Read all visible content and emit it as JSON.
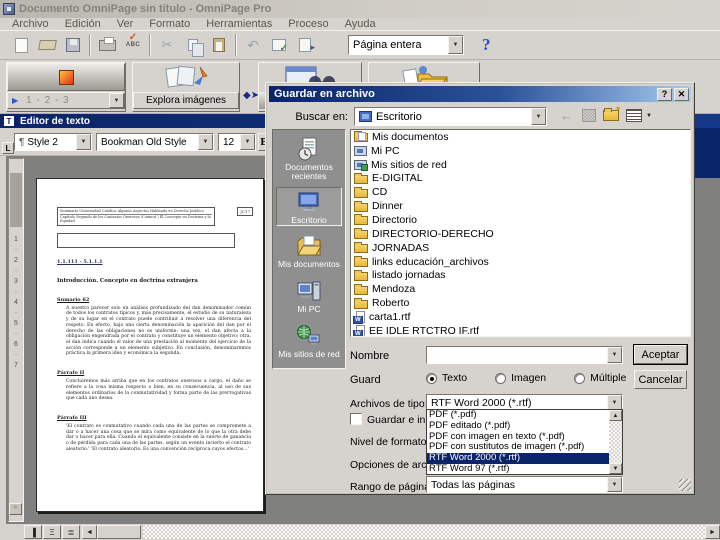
{
  "colors": {
    "window_bg": "#d6d3ce",
    "titlebar_inactive": "#c6c3bb",
    "accent_navy": "#0a246a",
    "doc_area_gray": "#80807e",
    "places_bar_gray": "#8f8f8f",
    "selection_bg": "#0a246a",
    "selection_text": "#ffffff"
  },
  "window": {
    "title": "Documento OmniPage sin título - OmniPage Pro"
  },
  "menu": [
    "Archivo",
    "Edición",
    "Ver",
    "Formato",
    "Herramientas",
    "Proceso",
    "Ayuda"
  ],
  "toolbar": {
    "page_view_value": "Página entera",
    "help": "?"
  },
  "workflow": {
    "steps": "1 - 2 - 3",
    "explore": "Explora imágenes"
  },
  "editor": {
    "title": "Editor de texto",
    "panel_icon": "T",
    "tab_button": "L",
    "style_value": "Style 2",
    "font_value": "Bookman Old Style",
    "size_value": "12",
    "bold_button": "B",
    "ruler": [
      "1",
      "2",
      "3",
      "4",
      "5",
      "6",
      "7"
    ]
  },
  "page": {
    "header_line1": "Seminario Universidad Católica  Algunos Aspectos Hablando en Derecho Jurídico",
    "header_line2": "Capítulo Segundo de los Contratos Onerosos (Conmut.)  El Concepto en Doctrina y la Equidad",
    "page_ref": "JC17",
    "link_heading": "1.1.111 - 5.1.1.1",
    "intro_heading": "Introducción. Concepto en doctrina extranjera",
    "sections": [
      {
        "heading": "Sumario 62",
        "body": "A nuestro parecer solo un análisis profundizado del dan denominador común de todos los contratos típicos y, más precisamente, el estudio de su naturaleza y de su lugar en el contrato puede contribuir a resolver una diferencia del respeto. En efecto, bajo una cierta denominación la aparición del dan por el derecho de las obligaciones no es uniforme: una vez, el dan afecta a la obligación engendrada por el contrato y constituye un elemento objetivo; otra, el dan indica cuando el valor de una prestación al momento del ejercicio de la acción corresponde a un elemento subjetivo. En conclusión, denominaremos práctica la primera idea y económica la segunda."
      },
      {
        "heading": "Párrafo II",
        "body": "Concluiremos más arriba que en los contratos onerosos a cargo, el daño se refiere a la cosa misma respecto o bien, en su consecuencia, al uso de sus elementos ordinarios de la conmutatividad y forma parte de las prerrogativas que cada uno desea."
      },
      {
        "heading": "Párrafo III",
        "body": "'El contrato es conmutativo cuando cada una de las partes se compromete a dar o a hacer una cosa que se mira como equivalente de lo que la otra debe dar o hacer para ella. Cuando el equivalente consiste en la suerte de ganancia o de pérdida para cada una de las partes, según un evento incierto el contrato aleatorio.'  'El contrato aleatorio. Es una convención recíproca cuyos efectos...'"
      }
    ]
  },
  "dialog": {
    "title": "Guardar en archivo",
    "help_button": "?",
    "close_button": "✕",
    "look_in": {
      "label": "Buscar en:",
      "value": "Escritorio"
    },
    "places": [
      {
        "label": "Documentos recientes",
        "icon": "recent-documents-icon",
        "selected": false
      },
      {
        "label": "Escritorio",
        "icon": "desktop-icon",
        "selected": true
      },
      {
        "label": "Mis documentos",
        "icon": "my-documents-icon",
        "selected": false
      },
      {
        "label": "Mi PC",
        "icon": "my-computer-icon",
        "selected": false
      },
      {
        "label": "Mis sitios de red",
        "icon": "network-places-icon",
        "selected": false
      }
    ],
    "files": [
      {
        "name": "Mis documentos",
        "type": "docs"
      },
      {
        "name": "Mi PC",
        "type": "pc"
      },
      {
        "name": "Mis sitios de red",
        "type": "net"
      },
      {
        "name": "E-DIGITAL",
        "type": "folder"
      },
      {
        "name": "CD",
        "type": "folder"
      },
      {
        "name": "Dinner",
        "type": "folder"
      },
      {
        "name": "Directorio",
        "type": "folder"
      },
      {
        "name": "DIRECTORIO-DERECHO",
        "type": "folder"
      },
      {
        "name": "JORNADAS",
        "type": "folder"
      },
      {
        "name": "links educación_archivos",
        "type": "folder"
      },
      {
        "name": "listado jornadas",
        "type": "folder"
      },
      {
        "name": "Mendoza",
        "type": "folder"
      },
      {
        "name": "Roberto",
        "type": "folder"
      },
      {
        "name": "carta1.rtf",
        "type": "rtf"
      },
      {
        "name": "EE IDLE RTCTRO IF.rtf",
        "type": "rtf"
      }
    ],
    "fields": {
      "name_label": "Nombre",
      "name_value": "",
      "save_label": "Guard",
      "radios": [
        {
          "label": "Texto",
          "selected": true
        },
        {
          "label": "Imagen",
          "selected": false
        },
        {
          "label": "Múltiple",
          "selected": false
        }
      ],
      "file_type_label": "Archivos de tipo:",
      "file_type_value": "RTF Word 2000 (*.rtf)",
      "save_launch_label": "Guardar e iniciar",
      "format_level_label": "Nivel de formato:",
      "file_options_label": "Opciones de archivo:",
      "page_range_label": "Rango de páginas:",
      "page_range_value": "Todas las páginas"
    },
    "type_options": {
      "selected_index": 4,
      "items": [
        "PDF (*.pdf)",
        "PDF editado (*.pdf)",
        "PDF con imagen en texto (*.pdf)",
        "PDF con sustitutos de imagen (*.pdf)",
        "RTF Word 2000 (*.rtf)",
        "RTF Word 97 (*.rtf)"
      ]
    },
    "buttons": {
      "ok": "Aceptar",
      "cancel": "Cancelar"
    }
  }
}
